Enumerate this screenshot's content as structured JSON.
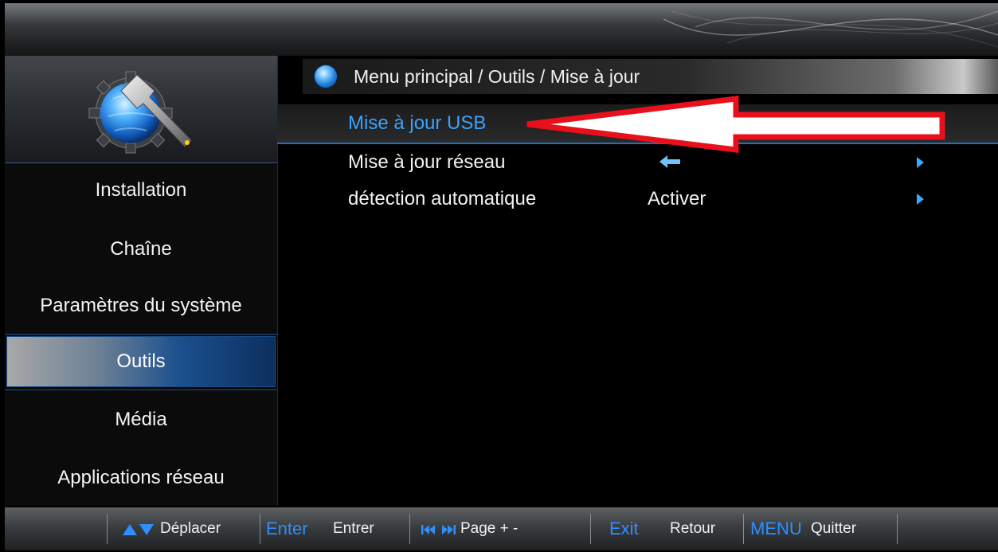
{
  "breadcrumb": "Menu principal / Outils / Mise à jour",
  "sidebar": {
    "items": [
      {
        "label": "Installation"
      },
      {
        "label": "Chaîne"
      },
      {
        "label": "Paramètres du système"
      },
      {
        "label": "Outils",
        "active": true
      },
      {
        "label": "Média"
      },
      {
        "label": "Applications réseau"
      }
    ]
  },
  "menu": {
    "rows": [
      {
        "label": "Mise à jour USB",
        "value": "",
        "selected": true
      },
      {
        "label": "Mise à jour réseau",
        "value": "",
        "value_icon": "left-arrow-icon",
        "has_submenu": true
      },
      {
        "label": "détection automatique",
        "value": "Activer",
        "has_submenu": true
      }
    ]
  },
  "footer": {
    "move_label": "Déplacer",
    "enter_key": "Enter",
    "enter_label": "Entrer",
    "page_label": "Page + -",
    "exit_key": "Exit",
    "exit_label": "Retour",
    "menu_key": "MENU",
    "menu_label": "Quitter"
  },
  "colors": {
    "accent": "#2e8fff",
    "selected_text": "#3aa3ff",
    "annotation_arrow": "#e8101a"
  }
}
